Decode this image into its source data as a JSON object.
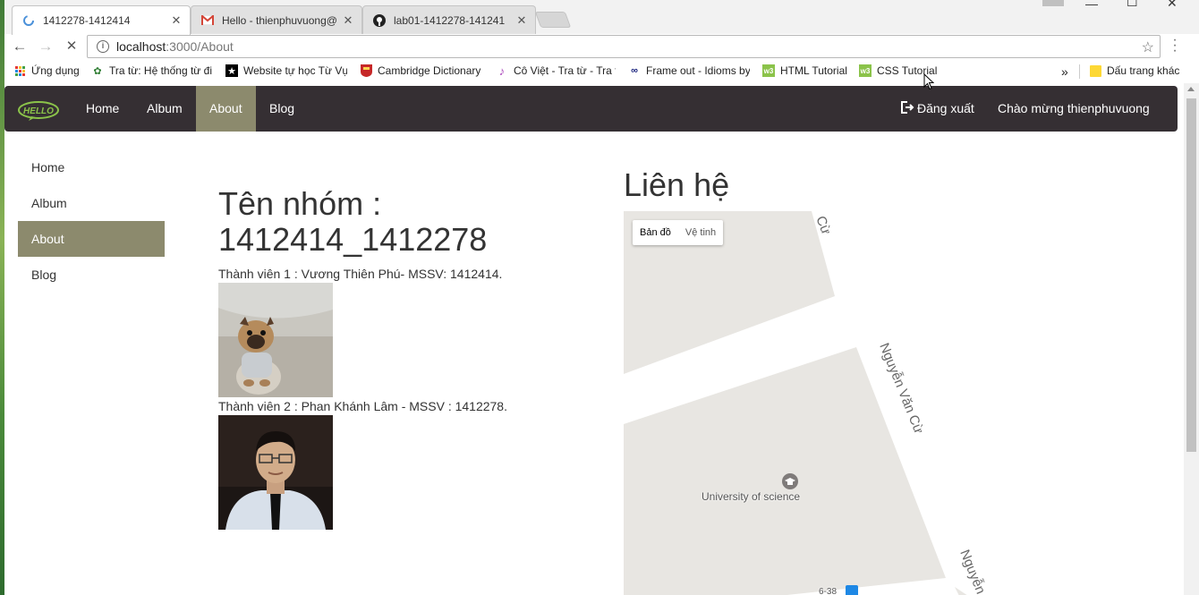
{
  "browser": {
    "tabs": [
      {
        "title": "1412278-1412414",
        "active": true
      },
      {
        "title": "Hello - thienphuvuong@",
        "active": false
      },
      {
        "title": "lab01-1412278-141241",
        "active": false
      }
    ],
    "url_host": "localhost",
    "url_path": ":3000/About",
    "bookmarks": [
      {
        "label": "Ứng dụng",
        "icon": "apps-icon"
      },
      {
        "label": "Tra từ: Hệ thống từ đi",
        "icon": "tratu-icon"
      },
      {
        "label": "Website tự học Từ Vựng",
        "icon": "star-icon"
      },
      {
        "label": "Cambridge Dictionary",
        "icon": "cambridge-icon"
      },
      {
        "label": "Cô Việt - Tra từ - Tra t",
        "icon": "covet-icon"
      },
      {
        "label": "Frame out - Idioms by",
        "icon": "idioms-icon"
      },
      {
        "label": "HTML Tutorial",
        "icon": "w3-icon"
      },
      {
        "label": "CSS Tutorial",
        "icon": "w3-icon"
      }
    ],
    "bookmarks_overflow": "»",
    "other_bookmarks": "Dấu trang khác"
  },
  "site": {
    "brand": "HELLO",
    "nav": [
      "Home",
      "Album",
      "About",
      "Blog"
    ],
    "active_nav": "About",
    "logout": "Đăng xuất",
    "greeting": "Chào mừng thienphuvuong"
  },
  "sidebar": {
    "items": [
      {
        "label": "Home",
        "active": false
      },
      {
        "label": "Album",
        "active": false
      },
      {
        "label": "About",
        "active": true
      },
      {
        "label": "Blog",
        "active": false
      }
    ]
  },
  "main": {
    "group_title": "Tên nhóm : 1412414_1412278",
    "members": [
      {
        "text": "Thành viên 1 : Vương Thiên Phú- MSSV: 1412414."
      },
      {
        "text": "Thành viên 2 : Phan Khánh Lâm - MSSV : 1412278."
      }
    ]
  },
  "contact": {
    "title": "Liên hệ",
    "map_buttons": [
      "Bản đồ",
      "Vệ tinh"
    ],
    "poi": "University of science",
    "streets": [
      "Nguyễn Văn Cừ",
      "Cừ",
      "Nguyễn"
    ],
    "bus_stop": "6-38"
  },
  "colors": {
    "navbar_bg": "#352f33",
    "active_bg": "#8c8a6d"
  }
}
